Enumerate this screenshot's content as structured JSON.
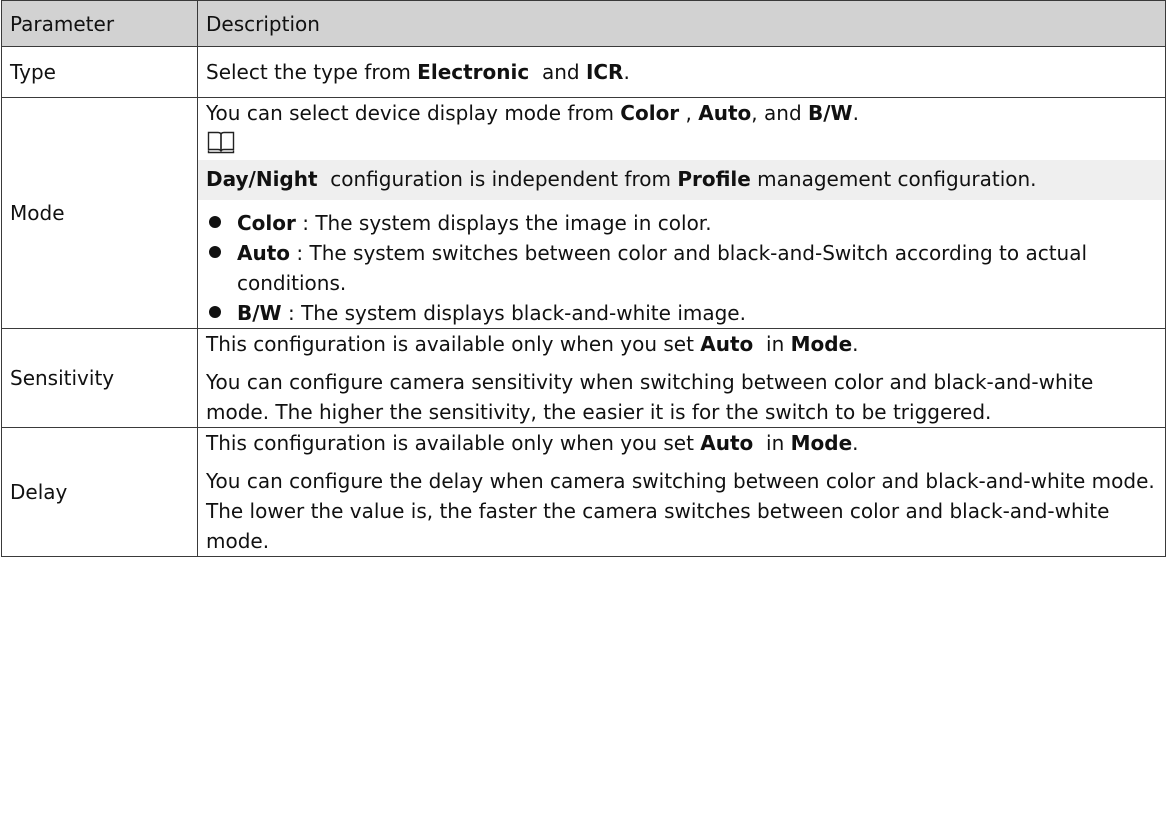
{
  "table": {
    "headers": {
      "parameter": "Parameter",
      "description": "Description"
    },
    "type_row": {
      "name": "Type",
      "pre": "Select the type from ",
      "opt1": "Electronic",
      "mid": "  and ",
      "opt2": "ICR",
      "post": "."
    },
    "mode_row": {
      "name": "Mode",
      "intro_pre": "You can select device display mode from ",
      "opt1": "Color",
      "sep1": " , ",
      "opt2": "Auto",
      "sep2": ", and ",
      "opt3": "B/W",
      "intro_post": ".",
      "note_icon": "book-icon",
      "note_bold1": "Day/Night",
      "note_mid": "  configuration is independent from ",
      "note_bold2": "Profile",
      "note_post": " management configuration.",
      "bullets": [
        {
          "term": "Color",
          "text": " : The system displays the image in color."
        },
        {
          "term": "Auto",
          "text": " : The system switches between color and black-and-Switch according to actual conditions."
        },
        {
          "term": "B/W",
          "text": " : The system displays black-and-white image."
        }
      ]
    },
    "sensitivity_row": {
      "name": "Sensitivity",
      "avail_pre": "This configuration is available only when you set ",
      "avail_bold1": "Auto",
      "avail_mid": "  in ",
      "avail_bold2": "Mode",
      "avail_post": ".",
      "detail": "You can configure camera sensitivity when switching between color and black-and-white mode. The higher the sensitivity, the easier it is for the switch to be triggered."
    },
    "delay_row": {
      "name": "Delay",
      "avail_pre": "This configuration is available only when you set ",
      "avail_bold1": "Auto",
      "avail_mid": "  in ",
      "avail_bold2": "Mode",
      "avail_post": ".",
      "detail": "You can configure the delay when camera switching between color and black-and-white mode. The lower the value is, the faster the camera switches between color and black-and-white mode."
    }
  }
}
